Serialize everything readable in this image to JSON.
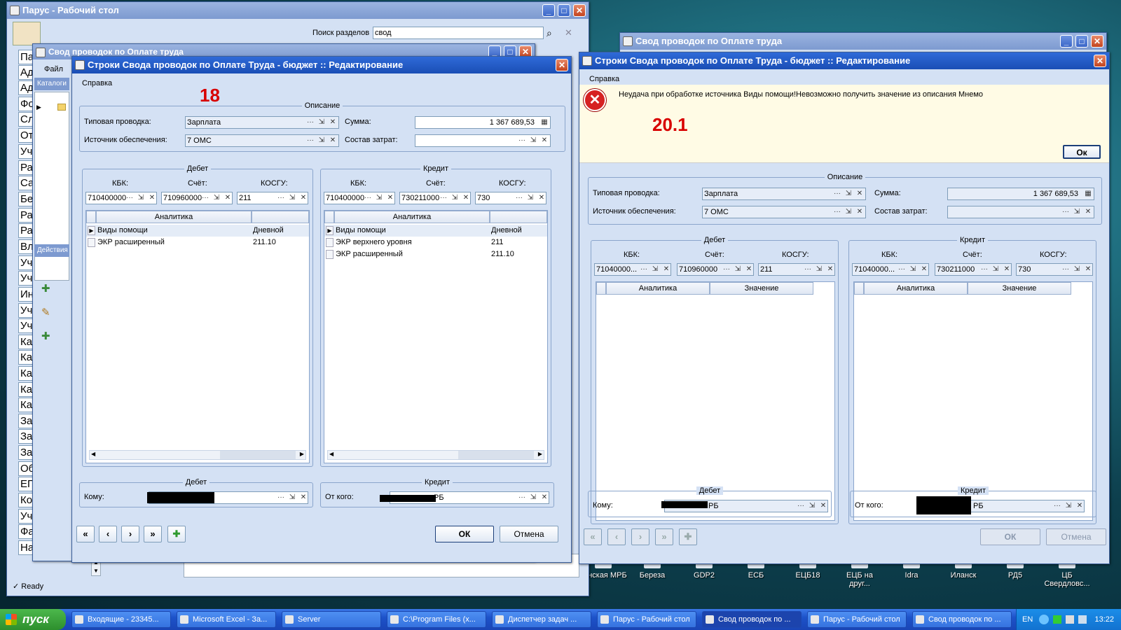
{
  "desktop": {
    "icons": [
      {
        "label": "чинская МРБ"
      },
      {
        "label": "Береза"
      },
      {
        "label": "GDP2"
      },
      {
        "label": "ЕСБ"
      },
      {
        "label": "ЕЦБ18"
      },
      {
        "label": "ЕЦБ на друг..."
      },
      {
        "label": "Idra"
      },
      {
        "label": "Иланск"
      },
      {
        "label": "РД5"
      },
      {
        "label": "ЦБ Свердловс..."
      }
    ]
  },
  "main_window": {
    "title": "Парус - Рабочий стол",
    "search_label": "Поиск разделов",
    "search_value": "свод",
    "status": "Ready",
    "sidebar": [
      "Пар",
      "Адм",
      "Адм",
      "Фон",
      "Сло",
      "Отч",
      "Уче",
      "Рас",
      "Сан",
      "Без",
      "Рас",
      "Рас",
      "Вло",
      "Уче",
      "Уче",
      "Ине",
      "Уче",
      "Уче",
      "Кад",
      "Кад",
      "Кад",
      "Кад",
      "Кад",
      "Зар",
      "Заработная",
      "Заработная",
      "Общие отра",
      "ЕГИСЗ",
      "Контроль да",
      "Учетная пол",
      "Фармацевт",
      "Настройки"
    ]
  },
  "bg_window_left": {
    "title": "Свод проводок по Оплате труда",
    "menu": "Файл",
    "catalog": "Каталоги",
    "actions": "Действия"
  },
  "bg_window_right": {
    "title": "Свод проводок по Оплате труда"
  },
  "dlg18": {
    "title": "Строки Свода проводок по Оплате Труда - бюджет :: Редактирование",
    "menu": "Справка",
    "annot": "18",
    "desc_legend": "Описание",
    "typ_label": "Типовая проводка:",
    "typ_value": "Зарплата",
    "src_label": "Источник обеспечения:",
    "src_value": "7 ОМС",
    "sum_label": "Сумма:",
    "sum_value": "1 367 689,53",
    "cost_label": "Состав затрат:",
    "cost_value": "",
    "debit": {
      "legend": "Дебет",
      "kbk_label": "КБК:",
      "kbk": "710400000",
      "acc_label": "Счёт:",
      "acc": "710960000",
      "kosgu_label": "КОСГУ:",
      "kosgu": "211",
      "col1": "Аналитика",
      "col2": "",
      "rows": [
        {
          "a": "Виды помощи",
          "v": "Дневной"
        },
        {
          "a": "ЭКР расширенный",
          "v": "211.10"
        }
      ]
    },
    "credit": {
      "legend": "Кредит",
      "kbk_label": "КБК:",
      "kbk": "710400000",
      "acc_label": "Счёт:",
      "acc": "730211000",
      "kosgu_label": "КОСГУ:",
      "kosgu": "730",
      "col1": "Аналитика",
      "col2": "",
      "rows": [
        {
          "a": "Виды помощи",
          "v": "Дневной"
        },
        {
          "a": "ЭКР верхнего уровня",
          "v": "211"
        },
        {
          "a": "ЭКР расширенный",
          "v": "211.10"
        }
      ]
    },
    "debit2": {
      "legend": "Дебет",
      "label": "Кому:"
    },
    "credit2": {
      "legend": "Кредит",
      "label": "От кого:",
      "value": "РБ"
    },
    "ok": "ОК",
    "cancel": "Отмена"
  },
  "dlg20": {
    "title": "Строки Свода проводок по Оплате Труда - бюджет :: Редактирование",
    "menu": "Справка",
    "annot": "20.1",
    "error": "Неудача при обработке источника Виды помощи!Невозможно получить значение из описания Мнемо",
    "error_ok": "Ок",
    "desc_legend": "Описание",
    "typ_label": "Типовая проводка:",
    "typ_value": "Зарплата",
    "src_label": "Источник обеспечения:",
    "src_value": "7 ОМС",
    "sum_label": "Сумма:",
    "sum_value": "1 367 689,53",
    "cost_label": "Состав затрат:",
    "debit": {
      "legend": "Дебет",
      "kbk_label": "КБК:",
      "kbk": "71040000...",
      "acc_label": "Счёт:",
      "acc": "710960000",
      "kosgu_label": "КОСГУ:",
      "kosgu": "211",
      "col1": "Аналитика",
      "col2": "Значение"
    },
    "credit": {
      "legend": "Кредит",
      "kbk_label": "КБК:",
      "kbk": "71040000...",
      "acc_label": "Счёт:",
      "acc": "730211000",
      "kosgu_label": "КОСГУ:",
      "kosgu": "730",
      "col1": "Аналитика",
      "col2": "Значение"
    },
    "debit2": {
      "legend": "Дебет",
      "label": "Кому:",
      "value": "РБ"
    },
    "credit2": {
      "legend": "Кредит",
      "label": "От кого:",
      "value": "РБ"
    },
    "ok": "ОК",
    "cancel": "Отмена"
  },
  "taskbar": {
    "start": "пуск",
    "items": [
      "Входящие - 23345...",
      "Microsoft Excel - За...",
      "Server",
      "C:\\Program Files (x...",
      "Диспетчер задач ...",
      "Парус - Рабочий стол",
      "Свод проводок по ...",
      "Парус - Рабочий стол",
      "Свод проводок по ..."
    ],
    "lang": "EN",
    "time": "13:22"
  }
}
